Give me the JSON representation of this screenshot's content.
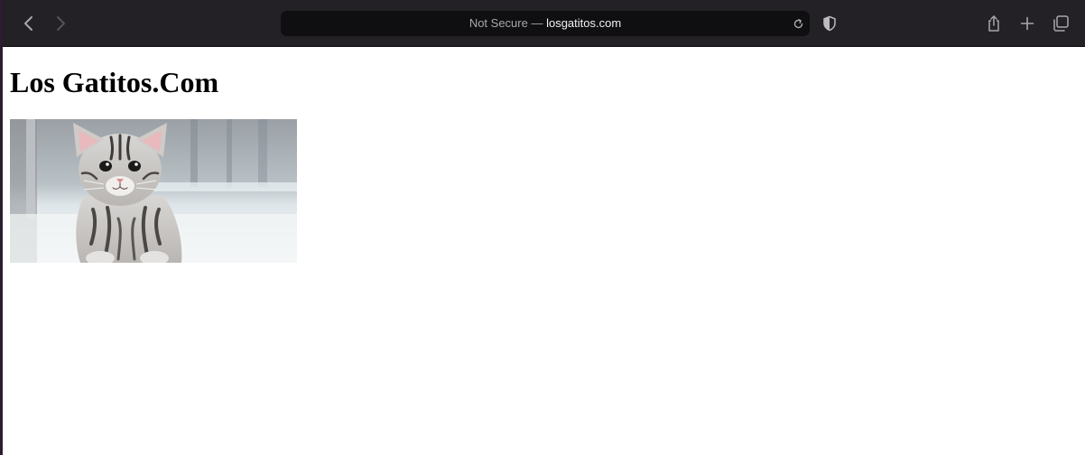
{
  "browser": {
    "address_prefix": "Not Secure — ",
    "address_domain": "losgatitos.com",
    "icons": {
      "back": "chevron-left-icon",
      "forward": "chevron-right-icon",
      "reload": "reload-icon",
      "privacy": "shield-icon",
      "share": "share-icon",
      "new_tab": "plus-icon",
      "tab_overview": "tabs-icon"
    },
    "colors": {
      "toolbar": "#232026",
      "address_bar": "#0f0e10"
    }
  },
  "page": {
    "heading": "Los Gatitos.Com",
    "image_alt": "kitten"
  }
}
